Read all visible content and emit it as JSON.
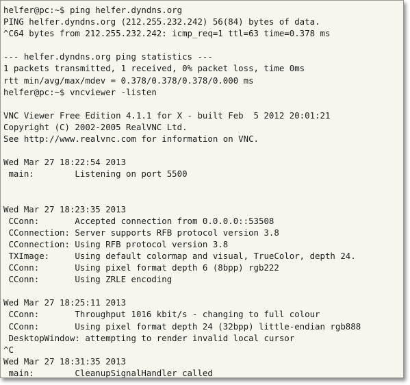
{
  "colors": {
    "background": "#f6f6ef",
    "text": "#1a1a1a"
  },
  "terminal": {
    "lines": [
      "helfer@pc:~$ ping helfer.dyndns.org",
      "PING helfer.dyndns.org (212.255.232.242) 56(84) bytes of data.",
      "^C64 bytes from 212.255.232.242: icmp_req=1 ttl=63 time=0.378 ms",
      "",
      "--- helfer.dyndns.org ping statistics ---",
      "1 packets transmitted, 1 received, 0% packet loss, time 0ms",
      "rtt min/avg/max/mdev = 0.378/0.378/0.378/0.000 ms",
      "helfer@pc:~$ vncviewer -listen",
      "",
      "VNC Viewer Free Edition 4.1.1 for X - built Feb  5 2012 20:01:21",
      "Copyright (C) 2002-2005 RealVNC Ltd.",
      "See http://www.realvnc.com for information on VNC.",
      "",
      "Wed Mar 27 18:22:54 2013",
      " main:        Listening on port 5500",
      "",
      "",
      "Wed Mar 27 18:23:35 2013",
      " CConn:       Accepted connection from 0.0.0.0::53508",
      " CConnection: Server supports RFB protocol version 3.8",
      " CConnection: Using RFB protocol version 3.8",
      " TXImage:     Using default colormap and visual, TrueColor, depth 24.",
      " CConn:       Using pixel format depth 6 (8bpp) rgb222",
      " CConn:       Using ZRLE encoding",
      "",
      "Wed Mar 27 18:25:11 2013",
      " CConn:       Throughput 1016 kbit/s - changing to full colour",
      " CConn:       Using pixel format depth 24 (32bpp) little-endian rgb888",
      " DesktopWindow: attempting to render invalid local cursor",
      "^C",
      "Wed Mar 27 18:31:35 2013",
      " main:        CleanupSignalHandler called"
    ]
  }
}
